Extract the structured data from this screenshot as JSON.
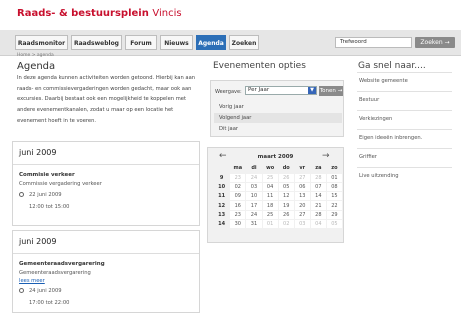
{
  "brand": {
    "title": "Raads- & bestuursplein",
    "subtitle": "Vincis"
  },
  "nav": {
    "tabs": [
      {
        "label": "Raadsmonitor"
      },
      {
        "label": "Raadsweblog"
      },
      {
        "label": "Forum"
      },
      {
        "label": "Nieuws"
      },
      {
        "label": "Agenda",
        "active": true
      },
      {
        "label": "Zoeken"
      }
    ],
    "search_value": "Trefwoord",
    "search_button": "Zoeken →"
  },
  "breadcrumb": "Home > agenda",
  "page_title": "Agenda",
  "intro": "In deze agenda kunnen activiteiten worden getoond. Hierbij kan aan raads- en commissievergaderingen worden gedacht, maar ook aan excursies. Daarbij bestaat ook een mogelijkheid te koppelen met andere evenementkanalen, zodat u maar op een locatie het evenement hoeft in te voeren.",
  "cards": [
    {
      "month": "juni 2009",
      "title": "Commisie verkeer",
      "text": "Commissie vergadering verkeer",
      "link": "",
      "date": "22 juni 2009",
      "time": "12:00 tot 15:00"
    },
    {
      "month": "juni 2009",
      "title": "Gemeenteraadsvergarering",
      "text": "Gemeenteraadsvergarering",
      "link": "lees meer",
      "date": "24 juni 2009",
      "time": "17:00 tot 22:00"
    }
  ],
  "event_options": {
    "title": "Evenementen opties",
    "label": "Weergave:",
    "select_value": "Per Jaar",
    "button": "Tonen →",
    "options": [
      "Vorig jaar",
      "Volgend jaar",
      "Dit jaar"
    ],
    "selected_index": 1
  },
  "calendar": {
    "month": "maart 2009",
    "prev": "←",
    "next": "→",
    "days": [
      "ma",
      "di",
      "wo",
      "do",
      "vr",
      "za",
      "zo"
    ],
    "weeks": [
      {
        "wk": "9",
        "d": [
          "23",
          "24",
          "25",
          "26",
          "27",
          "28",
          "01"
        ],
        "other": [
          1,
          1,
          1,
          1,
          1,
          1,
          0
        ]
      },
      {
        "wk": "10",
        "d": [
          "02",
          "03",
          "04",
          "05",
          "06",
          "07",
          "08"
        ],
        "other": [
          0,
          0,
          0,
          0,
          0,
          0,
          0
        ]
      },
      {
        "wk": "11",
        "d": [
          "09",
          "10",
          "11",
          "12",
          "13",
          "14",
          "15"
        ],
        "other": [
          0,
          0,
          0,
          0,
          0,
          0,
          0
        ]
      },
      {
        "wk": "12",
        "d": [
          "16",
          "17",
          "18",
          "19",
          "20",
          "21",
          "22"
        ],
        "other": [
          0,
          0,
          0,
          0,
          0,
          0,
          0
        ]
      },
      {
        "wk": "13",
        "d": [
          "23",
          "24",
          "25",
          "26",
          "27",
          "28",
          "29"
        ],
        "other": [
          0,
          0,
          0,
          0,
          0,
          0,
          0
        ]
      },
      {
        "wk": "14",
        "d": [
          "30",
          "31",
          "01",
          "02",
          "03",
          "04",
          "05"
        ],
        "other": [
          0,
          0,
          1,
          1,
          1,
          1,
          1
        ]
      }
    ]
  },
  "snel": {
    "title": "Ga snel naar....",
    "items": [
      "Website gemeente",
      "Bestuur",
      "Verkiezingen",
      "Eigen ideeën inbrengen.",
      "Griffier",
      "Live uitzending"
    ]
  }
}
